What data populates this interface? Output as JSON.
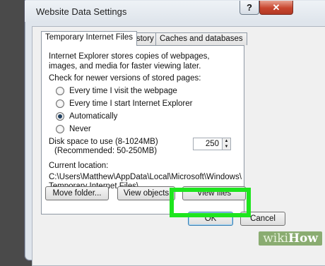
{
  "window": {
    "title": "Website Data Settings",
    "help_label": "?",
    "close_label": "✕"
  },
  "tabs": [
    {
      "label": "Temporary Internet Files",
      "active": true
    },
    {
      "label": "History",
      "active": false
    },
    {
      "label": "Caches and databases",
      "active": false
    }
  ],
  "panel": {
    "description": "Internet Explorer stores copies of webpages, images, and media for faster viewing later.",
    "check_label": "Check for newer versions of stored pages:",
    "radios": [
      {
        "label": "Every time I visit the webpage",
        "selected": false
      },
      {
        "label": "Every time I start Internet Explorer",
        "selected": false
      },
      {
        "label": "Automatically",
        "selected": true
      },
      {
        "label": "Never",
        "selected": false
      }
    ],
    "disk_label_line1": "Disk space to use (8-1024MB)",
    "disk_label_line2": "(Recommended: 50-250MB)",
    "disk_value": "250",
    "location_label": "Current location:",
    "location_path": "C:\\Users\\Matthew\\AppData\\Local\\Microsoft\\Windows\\ Temporary Internet Files\\"
  },
  "buttons": {
    "move_folder": "Move folder...",
    "view_objects": "View objects",
    "view_files": "View files",
    "ok": "OK",
    "cancel": "Cancel"
  },
  "watermark": {
    "wiki": "wiki",
    "how": "How"
  },
  "colors": {
    "highlight": "#1ee51e",
    "close_button": "#c8452e"
  }
}
